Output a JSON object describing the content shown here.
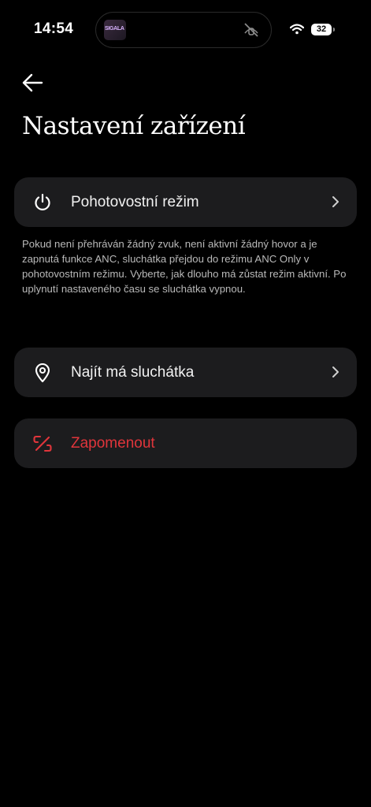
{
  "status_bar": {
    "time": "14:54",
    "now_playing_thumb_text": "SIGALA",
    "battery_level": "32",
    "icons": [
      "now-playing-thumbnail",
      "muted-mic-icon",
      "wifi-icon",
      "battery-icon"
    ]
  },
  "header": {
    "back_icon": "arrow-left-icon",
    "title": "Nastavení zařízení"
  },
  "standby": {
    "icon": "power-icon",
    "label": "Pohotovostní režim",
    "chevron": "chevron-right-icon",
    "description": "Pokud není přehráván žádný zvuk, není aktivní žádný hovor a je zapnutá funkce ANC, sluchátka přejdou do režimu ANC Only v pohotovostním režimu. Vyberte, jak dlouho má zůstat režim aktivní. Po uplynutí nastaveného času se sluchátka vypnou."
  },
  "find": {
    "icon": "location-pin-icon",
    "label": "Najít má sluchátka",
    "chevron": "chevron-right-icon"
  },
  "forget": {
    "icon": "unlink-icon",
    "label": "Zapomenout",
    "color": "#e0353b"
  },
  "colors": {
    "background": "#000000",
    "card": "#1c1c1e",
    "danger": "#e0353b",
    "secondary_text": "#b9b9b9"
  }
}
